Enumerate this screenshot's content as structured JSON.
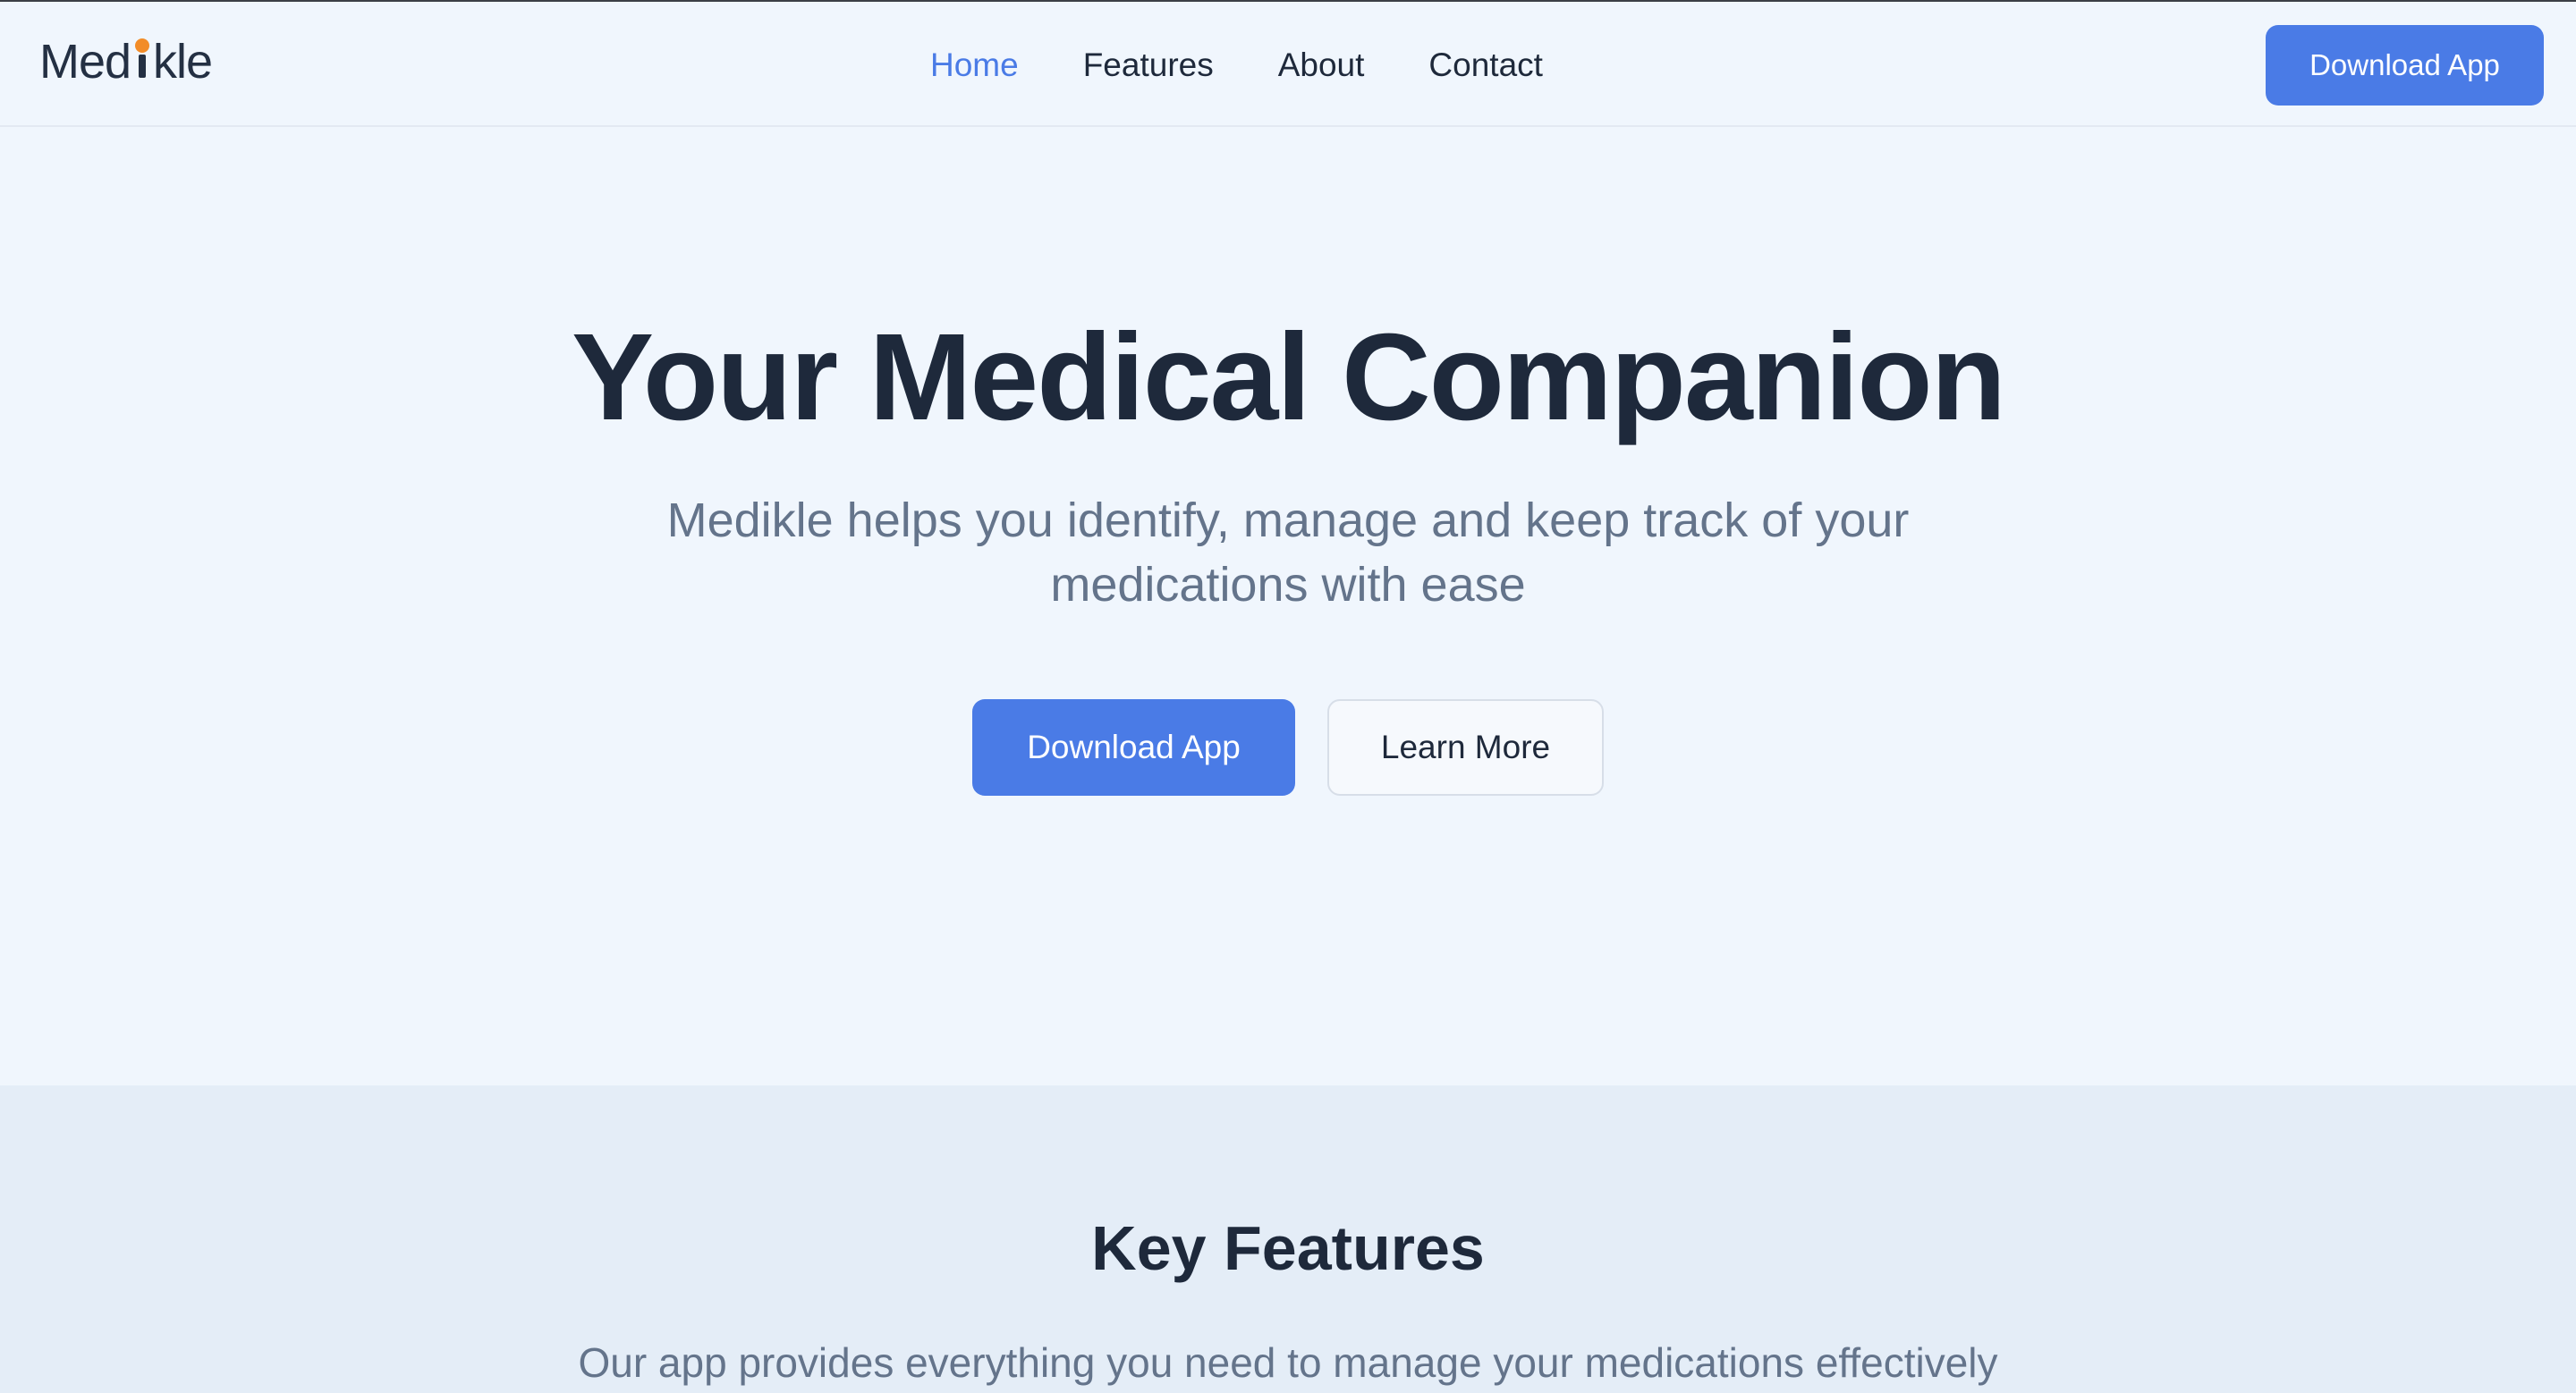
{
  "brand": {
    "name_start": "Med",
    "name_end": "kle",
    "accent_color": "#f28c28"
  },
  "nav": {
    "links": [
      {
        "label": "Home",
        "active": true
      },
      {
        "label": "Features",
        "active": false
      },
      {
        "label": "About",
        "active": false
      },
      {
        "label": "Contact",
        "active": false
      }
    ],
    "download_label": "Download App"
  },
  "hero": {
    "title": "Your Medical Companion",
    "subtitle": "Medikle helps you identify, manage and keep track of your medications with ease",
    "primary_label": "Download App",
    "secondary_label": "Learn More"
  },
  "features": {
    "title": "Key Features",
    "subtitle": "Our app provides everything you need to manage your medications effectively"
  },
  "colors": {
    "primary": "#4a7be6",
    "text_dark": "#1e293b",
    "text_muted": "#64748b",
    "background": "#f0f6fd",
    "section_background": "#e4edf7"
  }
}
